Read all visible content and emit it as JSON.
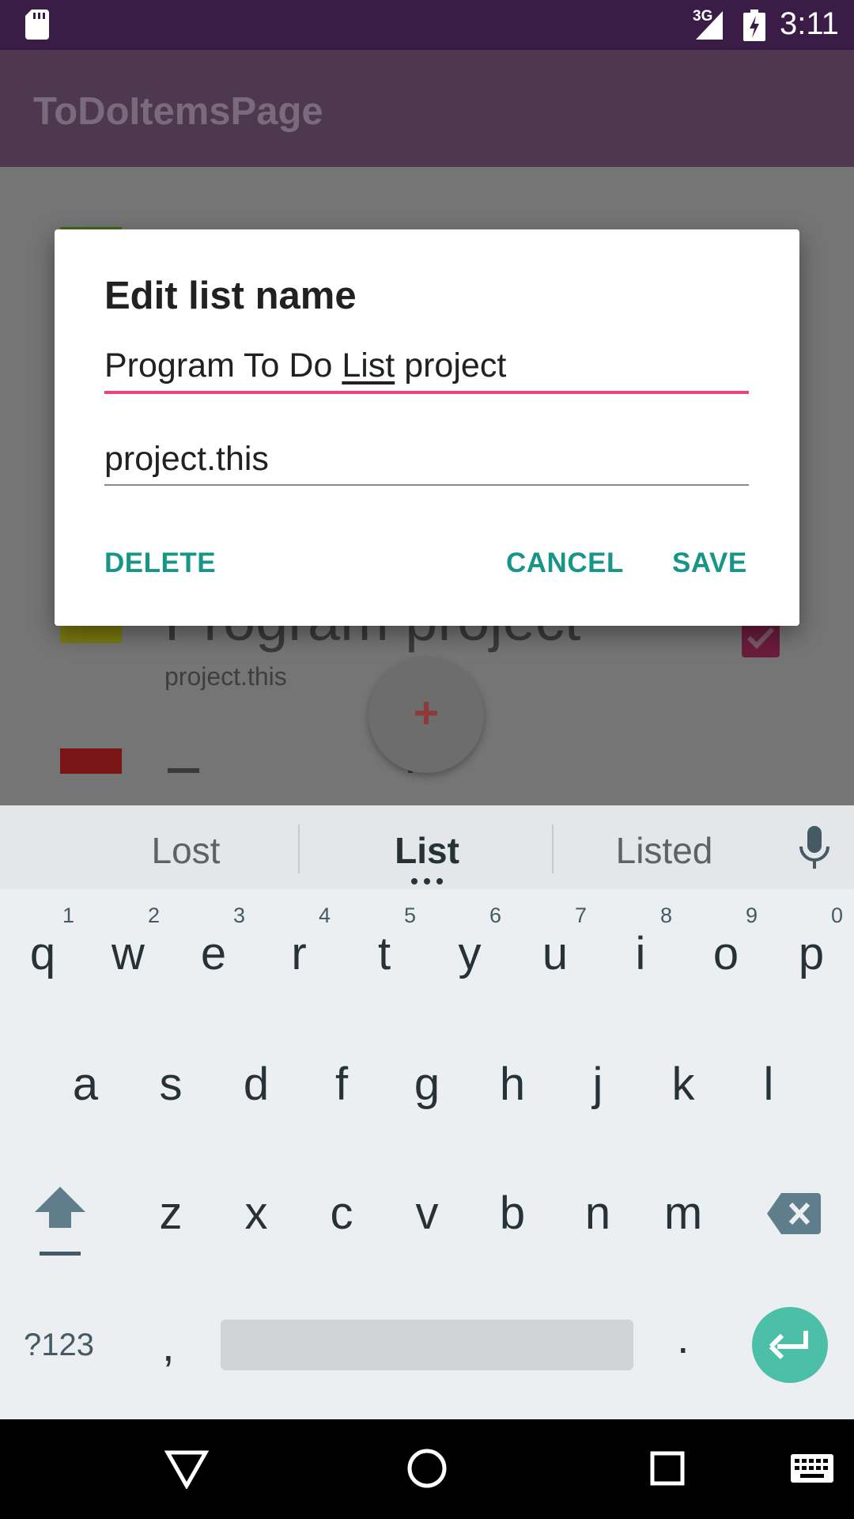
{
  "status_bar": {
    "network": "3G",
    "time": "3:11",
    "icons": [
      "sd-card-icon",
      "signal-icon",
      "battery-charging-icon"
    ]
  },
  "app_bar": {
    "title": "ToDoItemsPage"
  },
  "background_list": {
    "visible_item_title": "Program project",
    "visible_item_subtitle": "project.this",
    "fab_label": "+",
    "swatch_colors": [
      "#3d6b15",
      "#7a7a10",
      "#7a1515"
    ]
  },
  "dialog": {
    "title": "Edit list name",
    "name_value_before": "Program To Do ",
    "name_value_underlined": "List",
    "name_value_after": " project",
    "tag_value": "project.this",
    "delete_label": "DELETE",
    "cancel_label": "CANCEL",
    "save_label": "SAVE",
    "accent_color": "#179688",
    "focus_color": "#e8467c"
  },
  "keyboard": {
    "suggestions": [
      "Lost",
      "List",
      "Listed"
    ],
    "row1": [
      {
        "ch": "q",
        "num": "1"
      },
      {
        "ch": "w",
        "num": "2"
      },
      {
        "ch": "e",
        "num": "3"
      },
      {
        "ch": "r",
        "num": "4"
      },
      {
        "ch": "t",
        "num": "5"
      },
      {
        "ch": "y",
        "num": "6"
      },
      {
        "ch": "u",
        "num": "7"
      },
      {
        "ch": "i",
        "num": "8"
      },
      {
        "ch": "o",
        "num": "9"
      },
      {
        "ch": "p",
        "num": "0"
      }
    ],
    "row2": [
      "a",
      "s",
      "d",
      "f",
      "g",
      "h",
      "j",
      "k",
      "l"
    ],
    "row3": [
      "z",
      "x",
      "c",
      "v",
      "b",
      "n",
      "m"
    ],
    "symbols_label": "?123",
    "comma_label": ",",
    "period_label": "."
  },
  "nav_bar": {
    "icons": [
      "back-icon",
      "home-icon",
      "recents-icon",
      "keyboard-switch-icon"
    ]
  }
}
